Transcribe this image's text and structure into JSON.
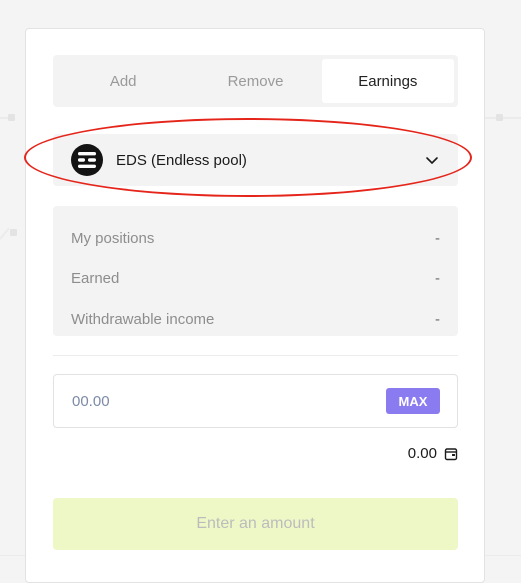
{
  "tabs": [
    {
      "label": "Add",
      "active": false
    },
    {
      "label": "Remove",
      "active": false
    },
    {
      "label": "Earnings",
      "active": true
    }
  ],
  "pool": {
    "name": "EDS (Endless pool)",
    "icon": "eds-logo-icon"
  },
  "stats": [
    {
      "label": "My positions",
      "value": "-"
    },
    {
      "label": "Earned",
      "value": "-"
    },
    {
      "label": "Withdrawable income",
      "value": "-"
    }
  ],
  "amount": {
    "placeholder": "00.00",
    "max_label": "MAX"
  },
  "balance": {
    "value": "0.00",
    "icon": "wallet-icon"
  },
  "submit": {
    "label": "Enter an amount"
  },
  "colors": {
    "accent_max": "#8b7bf0",
    "submit_bg": "#eef8c6",
    "highlight": "#e5241a"
  }
}
